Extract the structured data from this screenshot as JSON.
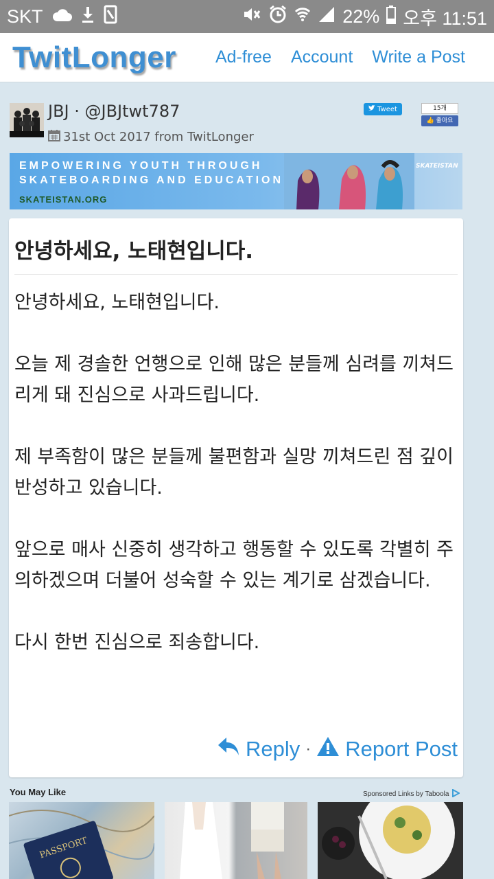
{
  "status_bar": {
    "carrier": "SKT",
    "battery": "22%",
    "time": "오후 11:51"
  },
  "nav": {
    "logo": "TwitLonger",
    "links": [
      "Ad-free",
      "Account",
      "Write a Post"
    ]
  },
  "author": {
    "name": "JBJ · @JBJtwt787",
    "date": "31st Oct 2017 from TwitLonger",
    "tweet_label": "Tweet",
    "like_count": "15개",
    "like_label": "좋아요"
  },
  "banner": {
    "line1": "EMPOWERING YOUTH THROUGH",
    "line2": "SKATEBOARDING AND EDUCATION",
    "site": "SKATEISTAN.ORG",
    "brand": "SKATEISTAN"
  },
  "post": {
    "title": "안녕하세요, 노태현입니다.",
    "paragraphs": [
      "안녕하세요, 노태현입니다.",
      "오늘 제 경솔한 언행으로 인해 많은 분들께 심려를 끼쳐드리게 돼 진심으로 사과드립니다.",
      "제 부족함이 많은 분들께 불편함과 실망 끼쳐드린 점 깊이 반성하고 있습니다.",
      "앞으로 매사 신중히 생각하고 행동할 수 있도록 각별히 주의하겠으며 더불어 성숙할 수 있는 계기로 삼겠습니다.",
      "다시 한번 진심으로 죄송합니다."
    ],
    "reply_label": "Reply",
    "separator": "·",
    "report_label": "Report Post"
  },
  "recommendations": {
    "title": "You May Like",
    "sponsored": "Sponsored Links by Taboola"
  },
  "colors": {
    "accent": "#2e8ed6",
    "background": "#d9e6ee",
    "status_bar": "#8a8a8a"
  }
}
